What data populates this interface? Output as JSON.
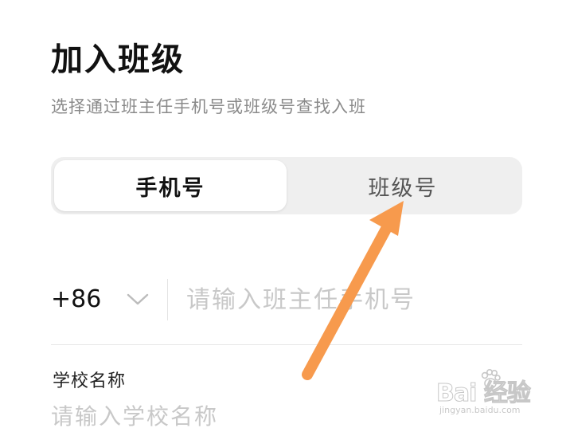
{
  "header": {
    "title": "加入班级",
    "subtitle": "选择通过班主任手机号或班级号查找入班"
  },
  "tabs": {
    "phone": "手机号",
    "class_number": "班级号",
    "selected": "phone"
  },
  "phone_field": {
    "country_code": "+86",
    "value": "",
    "placeholder": "请输入班主任手机号"
  },
  "school_field": {
    "label": "学校名称",
    "value": "",
    "placeholder": "请输入学校名称"
  },
  "annotation": {
    "arrow_color": "#f79a4d"
  },
  "watermark": {
    "brand": "Bai  经验",
    "url": "jingyan.baidu.com"
  },
  "icons": {
    "country_dropdown": "chevron-down-icon",
    "annotation": "arrow-up-icon",
    "watermark": "baidu-paw-icon"
  }
}
